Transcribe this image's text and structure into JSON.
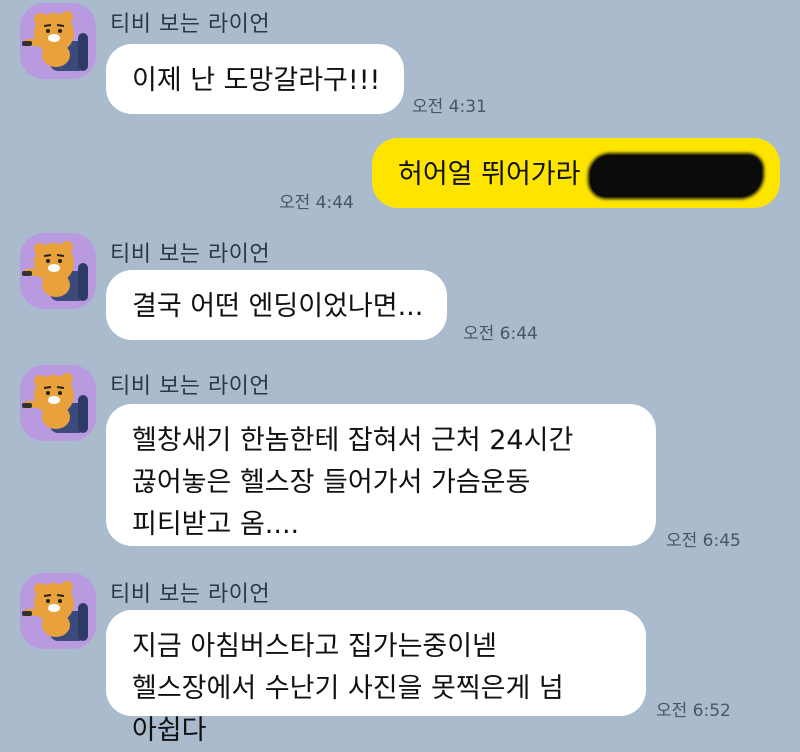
{
  "messages": [
    {
      "sender": "티비 보는 라이언",
      "text": "이제 난 도망갈라구!!!",
      "time": "오전 4:31"
    },
    {
      "text": "허어얼 뛰어가라",
      "time": "오전 4:44",
      "redacted": true
    },
    {
      "sender": "티비 보는 라이언",
      "text": "결국 어떤 엔딩이었나면...",
      "time": "오전 6:44"
    },
    {
      "sender": "티비 보는 라이언",
      "text": "헬창새기 한놈한테 잡혀서 근처 24시간 끊어놓은 헬스장 들어가서 가슴운동 피티받고 옴....",
      "time": "오전 6:45"
    },
    {
      "sender": "티비 보는 라이언",
      "text": "지금 아침버스타고 집가는중이넫 헬스장에서 수난기 사진을 못찍은게 넘 아쉽다",
      "time": "오전 6:52"
    }
  ],
  "colors": {
    "background": "#a9bbcd",
    "incoming_bubble": "#ffffff",
    "outgoing_bubble": "#fee500",
    "avatar_bg": "#b99ae0"
  },
  "icons": {
    "avatar": "ryan-lion-watching-tv-avatar"
  }
}
